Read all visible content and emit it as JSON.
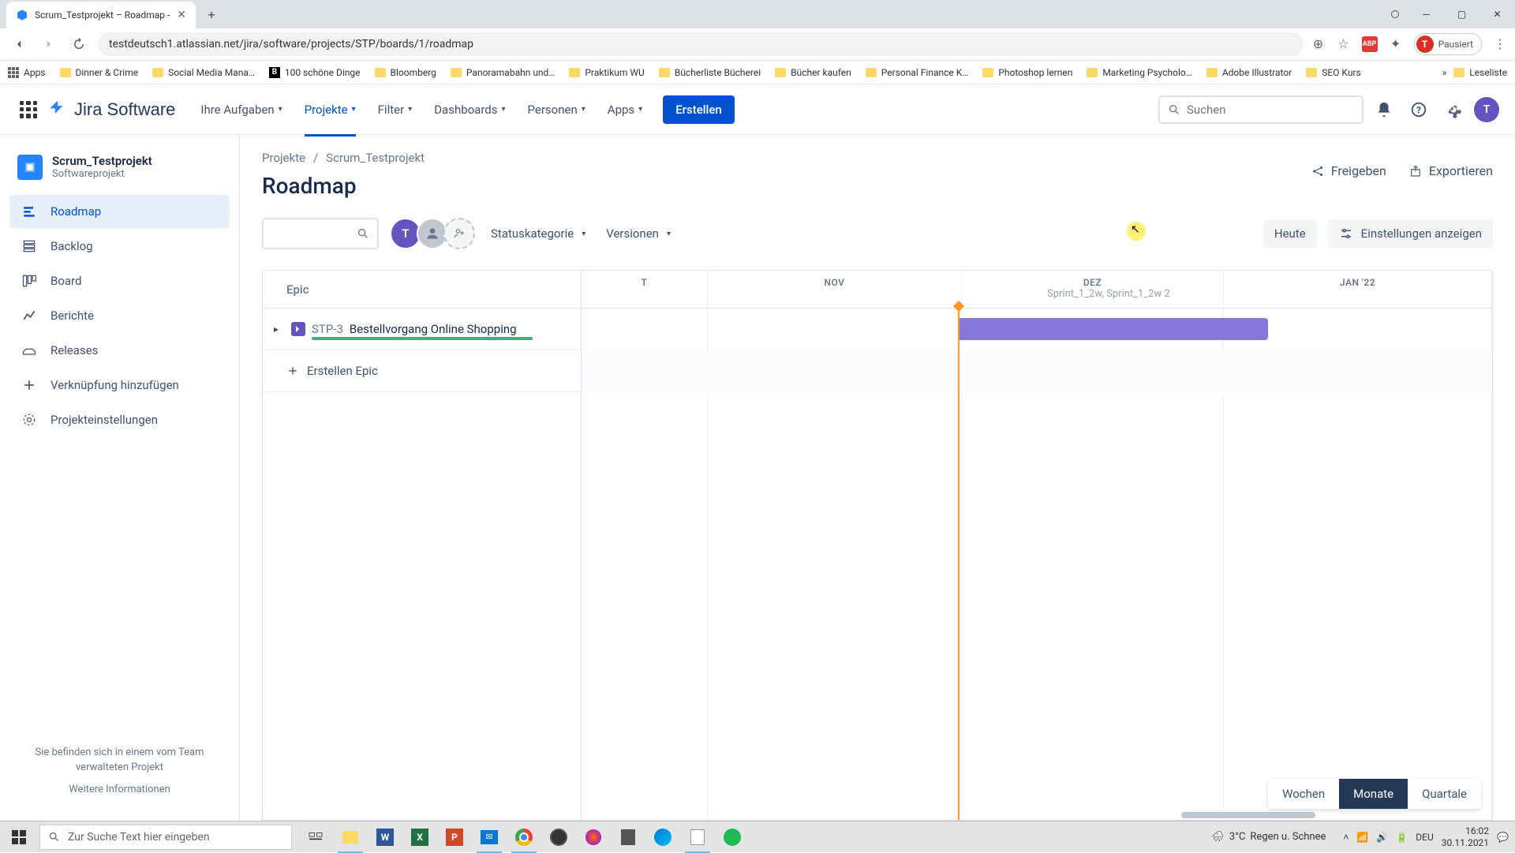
{
  "browser": {
    "tab_title": "Scrum_Testprojekt – Roadmap - ",
    "url": "testdeutsch1.atlassian.net/jira/software/projects/STP/boards/1/roadmap",
    "profile_status": "Pausiert",
    "profile_initial": "T",
    "bookmarks": [
      "Apps",
      "Dinner & Crime",
      "Social Media Mana…",
      "100 schöne Dinge",
      "Bloomberg",
      "Panoramabahn und…",
      "Praktikum WU",
      "Bücherliste Bücherei",
      "Bücher kaufen",
      "Personal Finance K…",
      "Photoshop lernen",
      "Marketing Psycholo…",
      "Adobe Illustrator",
      "SEO Kurs",
      "Leseliste"
    ]
  },
  "nav": {
    "product": "Jira Software",
    "items": [
      "Ihre Aufgaben",
      "Projekte",
      "Filter",
      "Dashboards",
      "Personen",
      "Apps"
    ],
    "create": "Erstellen",
    "search_placeholder": "Suchen",
    "avatar_initial": "T"
  },
  "sidebar": {
    "project_name": "Scrum_Testprojekt",
    "project_type": "Softwareprojekt",
    "items": [
      "Roadmap",
      "Backlog",
      "Board",
      "Berichte",
      "Releases",
      "Verknüpfung hinzufügen",
      "Projekteinstellungen"
    ],
    "footer_line1": "Sie befinden sich in einem vom Team verwalteten Projekt",
    "footer_link": "Weitere Informationen"
  },
  "page": {
    "breadcrumb1": "Projekte",
    "breadcrumb2": "Scrum_Testprojekt",
    "title": "Roadmap",
    "share": "Freigeben",
    "export": "Exportieren",
    "status_filter": "Statuskategorie",
    "version_filter": "Versionen",
    "today_btn": "Heute",
    "show_settings": "Einstellungen anzeigen",
    "avatar1": "T",
    "epic_column": "Epic",
    "months": [
      "T",
      "NOV",
      "DEZ",
      "JAN '22"
    ],
    "sprint_label": "Sprint_1_2w, Sprint_1_2w 2",
    "epic_key": "STP-3",
    "epic_title": "Bestellvorgang Online Shopping",
    "create_epic": "Erstellen Epic",
    "zoom": [
      "Wochen",
      "Monate",
      "Quartale"
    ]
  },
  "taskbar": {
    "search_placeholder": "Zur Suche Text hier eingeben",
    "weather_temp": "3°C",
    "weather_desc": "Regen u. Schnee",
    "lang": "DEU",
    "time": "16:02",
    "date": "30.11.2021"
  }
}
